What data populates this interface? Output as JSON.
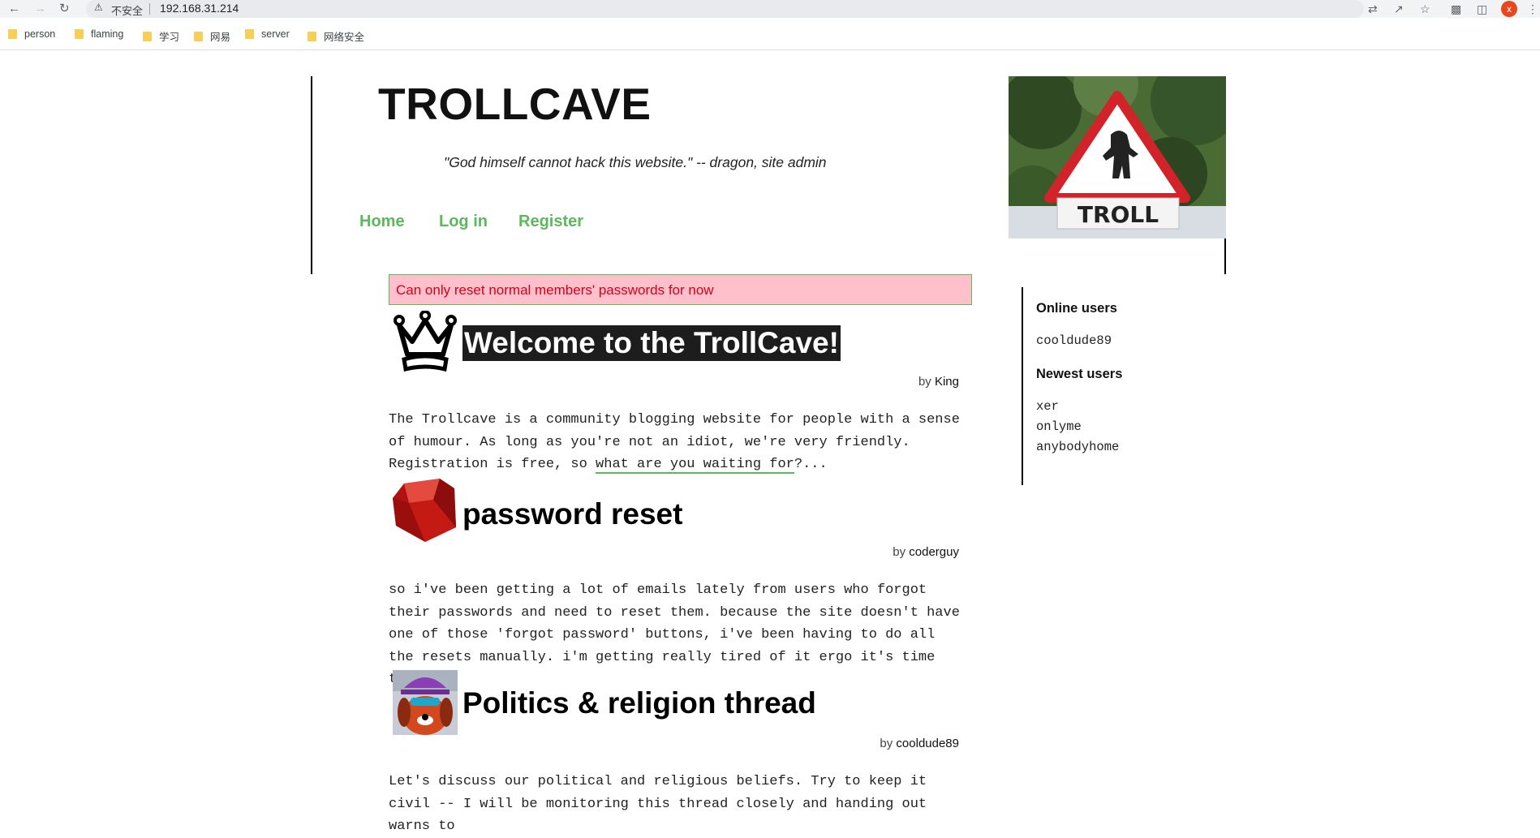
{
  "browser": {
    "insecure_label": "不安全",
    "url": "192.168.31.214",
    "avatar_letter": "x",
    "bookmarks": [
      {
        "label": "person"
      },
      {
        "label": "flaming"
      },
      {
        "label": "学习"
      },
      {
        "label": "网易"
      },
      {
        "label": "server"
      },
      {
        "label": "网络安全"
      }
    ]
  },
  "site": {
    "title": "TROLLCAVE",
    "quote": "\"God himself cannot hack this website.\" -- dragon, site admin",
    "banner_sign_text": "TROLL",
    "nav": [
      {
        "label": "Home"
      },
      {
        "label": "Log in"
      },
      {
        "label": "Register"
      }
    ]
  },
  "alert": {
    "message": "Can only reset normal members' passwords for now"
  },
  "posts": [
    {
      "icon": "crown-icon",
      "title": "Welcome to the TrollCave!",
      "by_prefix": "by ",
      "author": "King",
      "body_1": "The Trollcave is a community blogging website for people with a sense of humour. As long as you're not an idiot, we're very friendly. Registration is free, so ",
      "body_link": "what are you waiting for",
      "body_2": "?..."
    },
    {
      "icon": "ruby-icon",
      "title": "password reset",
      "by_prefix": "by ",
      "author": "coderguy",
      "body": "so i've been getting a lot of emails lately from users who forgot their passwords and need to reset them. because the site doesn't have one of those 'forgot password' buttons, i've been having to do all the resets manually. i'm getting really tired of it ergo it's time to..."
    },
    {
      "icon": "cartoon-dog-avatar-icon",
      "title": "Politics & religion thread",
      "by_prefix": "by ",
      "author": "cooldude89",
      "body": "Let's discuss our political and religious beliefs. Try to keep it civil -- I will be monitoring this thread closely and handing out warns to"
    }
  ],
  "sidebar": {
    "online_heading": "Online users",
    "online_users": [
      "cooldude89"
    ],
    "newest_heading": "Newest users",
    "newest_users": [
      "xer",
      "onlyme",
      "anybodyhome"
    ]
  },
  "colors": {
    "accent_green": "#5cb85c",
    "alert_bg": "#ffc0cb",
    "alert_text": "#d0021b"
  }
}
